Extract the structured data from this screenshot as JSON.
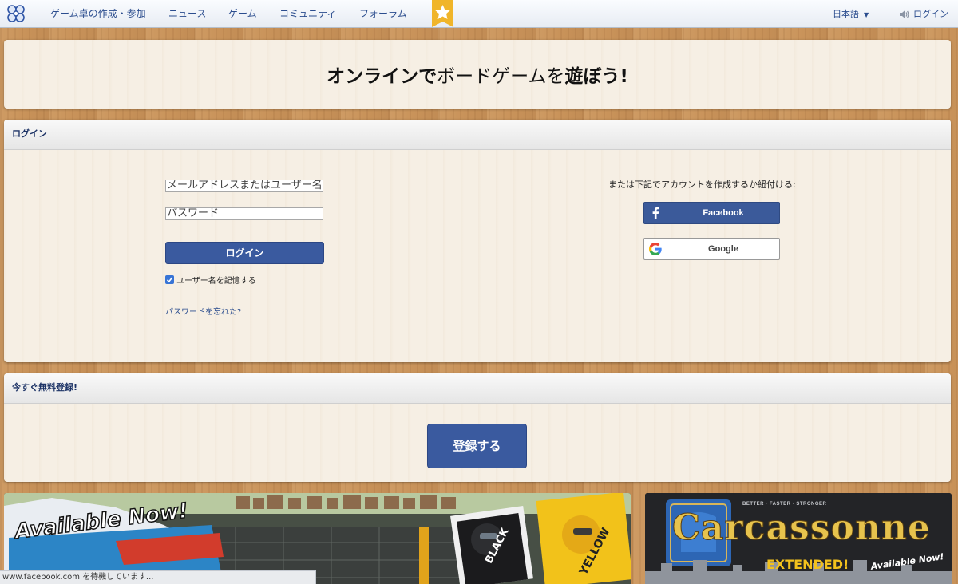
{
  "nav": {
    "items": [
      "ゲーム卓の作成・参加",
      "ニュース",
      "ゲーム",
      "コミュニティ",
      "フォーラム"
    ],
    "language": "日本語",
    "login": "ログイン"
  },
  "hero": {
    "part1": "オンラインで",
    "part2": "ボードゲーム",
    "part3": "を",
    "part4": "遊ぼう!"
  },
  "login_panel": {
    "title": "ログイン",
    "email_placeholder": "メールアドレスまたはユーザー名",
    "password_placeholder": "パスワード",
    "submit_label": "ログイン",
    "remember_label": "ユーザー名を記憶する",
    "remember_checked": true,
    "forgot_label": "パスワードを忘れた?",
    "or_text": "または下記でアカウントを作成するか紐付ける:",
    "facebook_label": "Facebook",
    "google_label": "Google"
  },
  "register_panel": {
    "title": "今すぐ無料登録!",
    "button_label": "登録する"
  },
  "banners": {
    "left_text": "Available Now!",
    "left_badge1": "BLACK",
    "left_badge2": "YELLOW",
    "right_tagline": "BETTER · FASTER · STRONGER",
    "right_title": "Carcassonne",
    "right_subtitle": "EXTENDED!",
    "right_available": "Available Now!"
  },
  "status_bar": {
    "text": "www.facebook.com を待機しています..."
  },
  "colors": {
    "primary_button": "#3a5a9f",
    "nav_text": "#2b4d8e",
    "panel_bg": "#f6efe4"
  }
}
